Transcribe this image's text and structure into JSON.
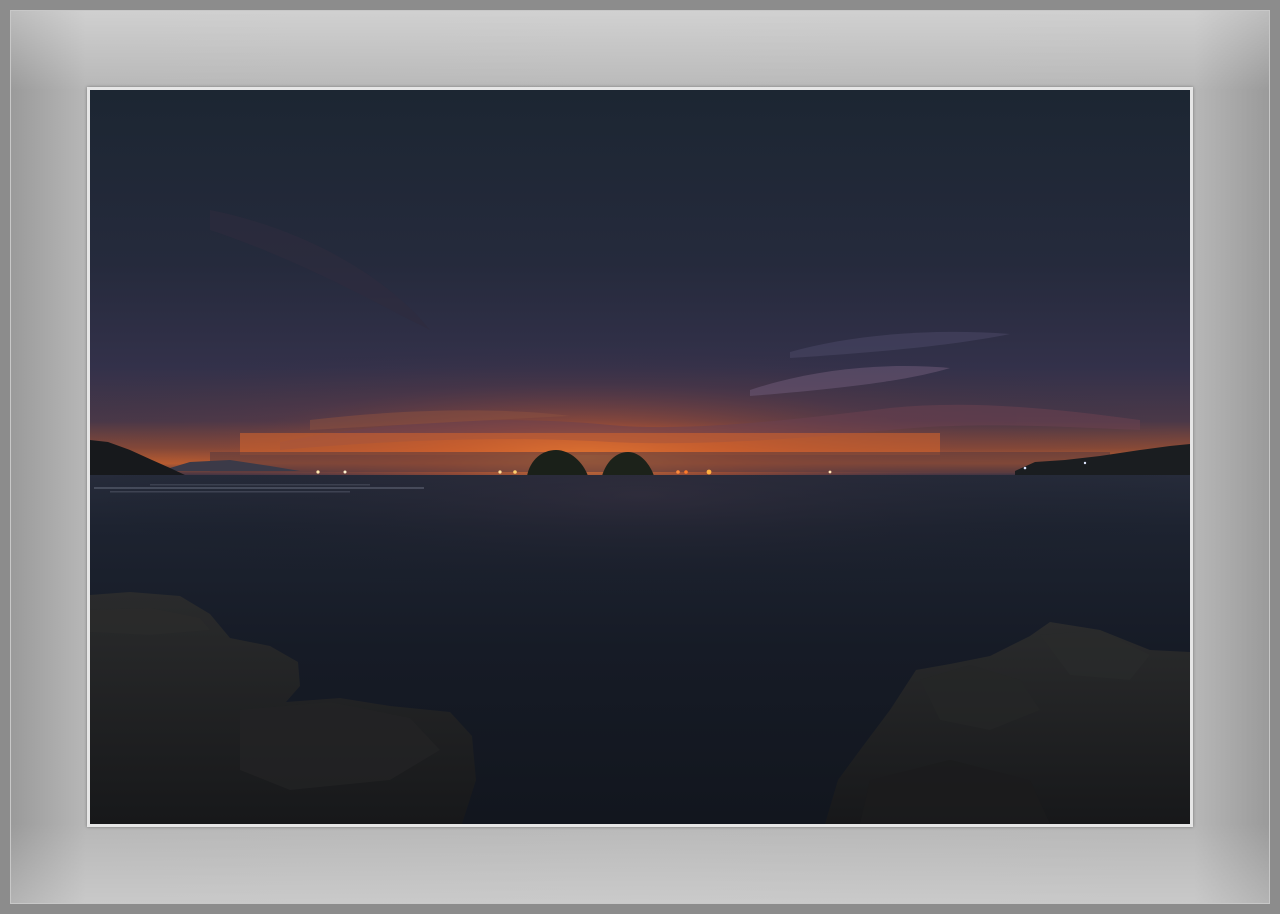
{
  "scene": {
    "subject": "",
    "colors": {
      "frame": "#8c8c8c",
      "mat": "#b9b9b9",
      "sky_top": "#1d2633",
      "sky_mid": "#2b2f44",
      "horizon_glow": "#e4702c",
      "sea": "#161c26",
      "rocks": "#1d1e20"
    }
  }
}
